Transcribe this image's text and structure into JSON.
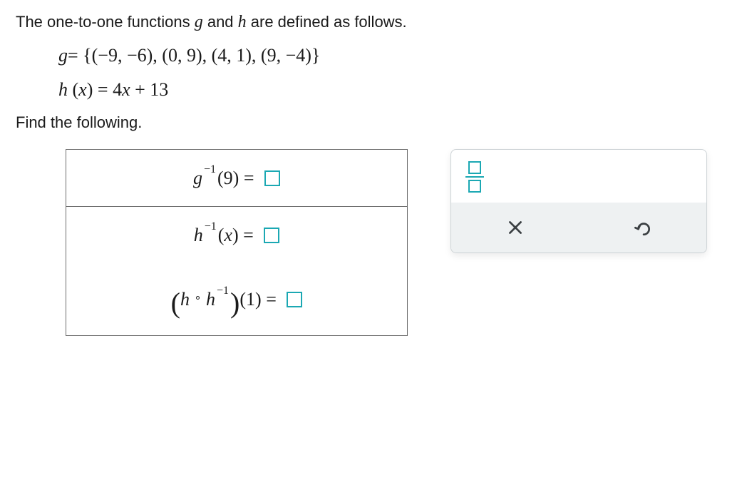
{
  "intro": "The one-to-one functions g and h are defined as follows.",
  "g_def_prefix": "g",
  "g_def_eq": "=",
  "g_set": "{(−9,  −6),  (0,  9),  (4,  1),  (9,  −4)}",
  "h_def_prefix": "h",
  "h_def_arg_open": "(",
  "h_def_arg": "x",
  "h_def_arg_close": ")",
  "h_def_eq": "=",
  "h_def_rhs": "4x + 13",
  "prompt2": "Find the following.",
  "rows": {
    "r1": {
      "base": "g",
      "exp": "−1",
      "arg": "9",
      "eq": "="
    },
    "r2": {
      "base": "h",
      "exp": "−1",
      "arg": "x",
      "eq": "="
    },
    "r3": {
      "outer": "h",
      "circ": "∘",
      "inner": "h",
      "exp": "−1",
      "arg": "1",
      "eq": "="
    }
  },
  "tools": {
    "fraction": "fraction-input",
    "clear": "clear",
    "undo": "undo"
  }
}
